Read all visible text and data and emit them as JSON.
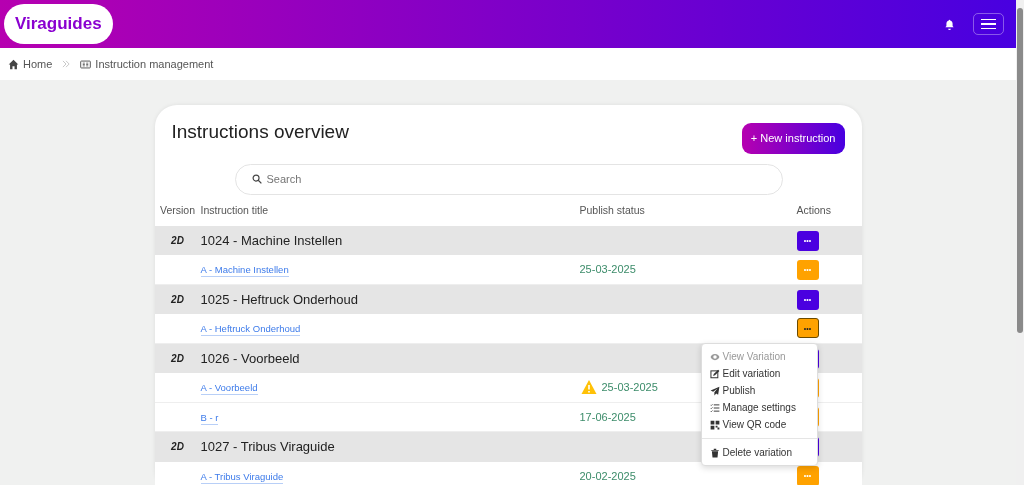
{
  "brand": "Viraguides",
  "breadcrumb": [
    {
      "label": "Home"
    },
    {
      "label": "Instruction management"
    }
  ],
  "page_title": "Instructions overview",
  "new_button": "+ New instruction",
  "search": {
    "placeholder": "Search"
  },
  "columns": [
    "Version",
    "Instruction title",
    "Publish status",
    "Actions"
  ],
  "groups": [
    {
      "version": "2D",
      "title": "1024 - Machine Instellen",
      "variations": [
        {
          "label": "A - Machine Instellen",
          "date": "25-03-2025",
          "warning": false,
          "menu_open": false
        }
      ]
    },
    {
      "version": "2D",
      "title": "1025 - Heftruck Onderhoud",
      "variations": [
        {
          "label": "A - Heftruck Onderhoud",
          "menu_open": true
        }
      ]
    },
    {
      "version": "2D",
      "title": "1026 - Voorbeeld",
      "variations": [
        {
          "label": "A - Voorbeeld",
          "date": "25-03-2025",
          "warning": true,
          "menu_open": false
        },
        {
          "label": "B - r",
          "date": "17-06-2025",
          "warning": false,
          "menu_open": false
        }
      ]
    },
    {
      "version": "2D",
      "title": "1027 - Tribus Viraguide",
      "variations": [
        {
          "label": "A - Tribus Viraguide",
          "date": "20-02-2025",
          "warning": false,
          "menu_open": false
        }
      ]
    }
  ],
  "action_button": "•••",
  "menu": [
    {
      "label": "View Variation",
      "disabled": true
    },
    {
      "label": "Edit variation",
      "disabled": false
    },
    {
      "label": "Publish",
      "disabled": false
    },
    {
      "label": "Manage settings",
      "disabled": false
    },
    {
      "label": "View QR code",
      "disabled": false
    },
    {
      "label": "Delete variation",
      "disabled": false,
      "separated": true
    }
  ]
}
